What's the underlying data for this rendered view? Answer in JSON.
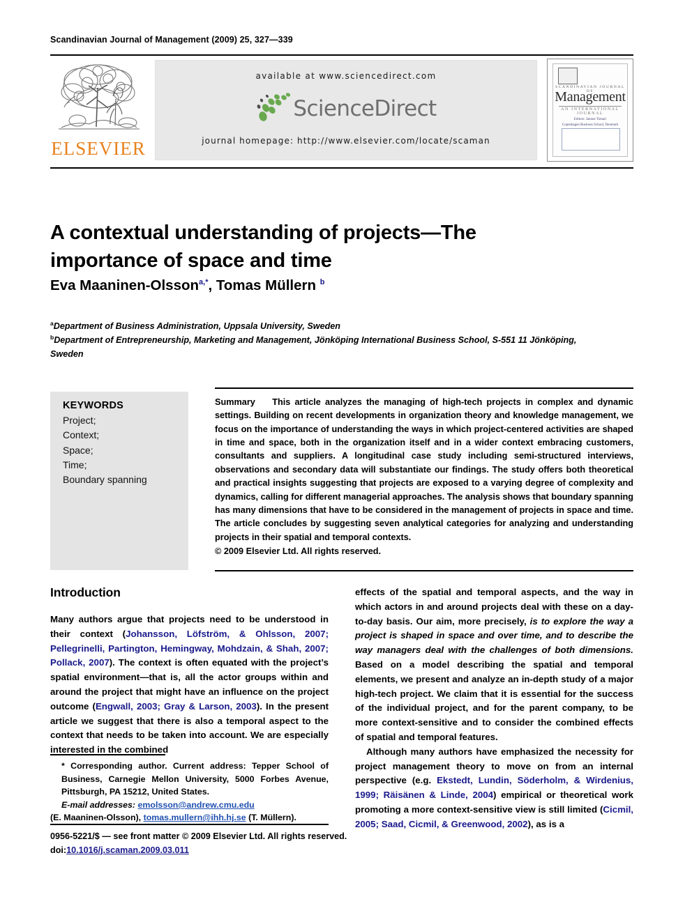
{
  "running_head": "Scandinavian Journal of Management (2009) 25, 327—339",
  "masthead": {
    "publisher_name": "ELSEVIER",
    "available_at": "available at www.sciencedirect.com",
    "sciencedirect_wordmark": "ScienceDirect",
    "journal_homepage": "journal homepage: http://www.elsevier.com/locate/scaman",
    "cover": {
      "journal_name_small": "SCANDINAVIAN JOURNAL OF",
      "journal_name_large": "Management",
      "journal_subtitle": "AN INTERNATIONAL JOURNAL",
      "editor_line": "Editors: Jannne Tienari",
      "editor_sub": "Copenhagen Business School, Denmark"
    }
  },
  "article": {
    "title": "A contextual understanding of projects—The importance of space and time",
    "authors_html": "Eva Maaninen-Olsson<sup>a,*</sup>, Tomas Müllern <sup>b</sup>",
    "affiliations": [
      {
        "marker": "a",
        "text": "Department of Business Administration, Uppsala University, Sweden"
      },
      {
        "marker": "b",
        "text": "Department of Entrepreneurship, Marketing and Management, Jönköping International Business School, S-551 11 Jönköping, Sweden"
      }
    ]
  },
  "keywords": {
    "heading": "KEYWORDS",
    "items": [
      "Project;",
      "Context;",
      "Space;",
      "Time;",
      "Boundary spanning"
    ]
  },
  "summary": {
    "label": "Summary",
    "text": "This article analyzes the managing of high-tech projects in complex and dynamic settings. Building on recent developments in organization theory and knowledge management, we focus on the importance of understanding the ways in which project-centered activities are shaped in time and space, both in the organization itself and in a wider context embracing customers, consultants and suppliers. A longitudinal case study including semi-structured interviews, observations and secondary data will substantiate our findings. The study offers both theoretical and practical insights suggesting that projects are exposed to a varying degree of complexity and dynamics, calling for different managerial approaches. The analysis shows that boundary spanning has many dimensions that have to be considered in the management of projects in space and time. The article concludes by suggesting seven analytical categories for analyzing and understanding projects in their spatial and temporal contexts.",
    "copyright": "© 2009 Elsevier Ltd. All rights reserved."
  },
  "body": {
    "section_heading": "Introduction",
    "left_paragraph_html": "Many authors argue that projects need to be understood in their context (<span class=\"cite\">Johansson, Löfström, &amp; Ohlsson, 2007; Pellegrinelli, Partington, Hemingway, Mohdzain, &amp; Shah, 2007; Pollack, 2007</span>). The context is often equated with the project’s spatial environment—that is, all the actor groups within and around the project that might have an influence on the project outcome (<span class=\"cite\">Engwall, 2003; Gray &amp; Larson, 2003</span>). In the present article we suggest that there is also a temporal aspect to the context that needs to be taken into account. We are especially interested in the combined",
    "right_paragraph_1_html": "effects of the spatial and temporal aspects, and the way in which actors in and around projects deal with these on a day-to-day basis. Our aim, more precisely, <span class=\"ital\">is to explore the way a project is shaped in space and over time, and to describe the way managers deal with the challenges of both dimensions.</span> Based on a model describing the spatial and temporal elements, we present and analyze an in-depth study of a major high-tech project. We claim that it is essential for the success of the individual project, and for the parent company, to be more context-sensitive and to consider the combined effects of spatial and temporal features.",
    "right_paragraph_2_html": "Although many authors have emphasized the necessity for project management theory to move on from an internal perspective (e.g. <span class=\"cite\">Ekstedt, Lundin, Söderholm, &amp; Wirdenius, 1999; Räisänen &amp; Linde, 2004</span>) empirical or theoretical work promoting a more context-sensitive view is still limited (<span class=\"cite\">Cicmil, 2005; Saad, Cicmil, &amp; Greenwood, 2002</span>), as is a"
  },
  "footnote": {
    "corresponding_html": "* Corresponding author. Current address: Tepper School of Business, Carnegie Mellon University, 5000 Forbes Avenue, Pittsburgh, PA 15212, United States.",
    "email_label": "E-mail addresses:",
    "email_1": "emolsson@andrew.cmu.edu",
    "email_1_owner": "(E. Maaninen-Olsson),",
    "email_2": "tomas.mullern@ihh.hj.se",
    "email_2_owner": "(T. Müllern)."
  },
  "imprint": {
    "issn_line": "0956-5221/$ — see front matter © 2009 Elsevier Ltd. All rights reserved.",
    "doi_prefix": "doi:",
    "doi_value": "10.1016/j.scaman.2009.03.011"
  },
  "colors": {
    "link_navy": "#1a1a8c",
    "mail_blue": "#2050b0",
    "elsevier_orange": "#E8821E",
    "sciencedirect_green": "#69A84F",
    "banner_gray": "#e8e8e8",
    "keyword_box_gray": "#e4e4e4"
  }
}
